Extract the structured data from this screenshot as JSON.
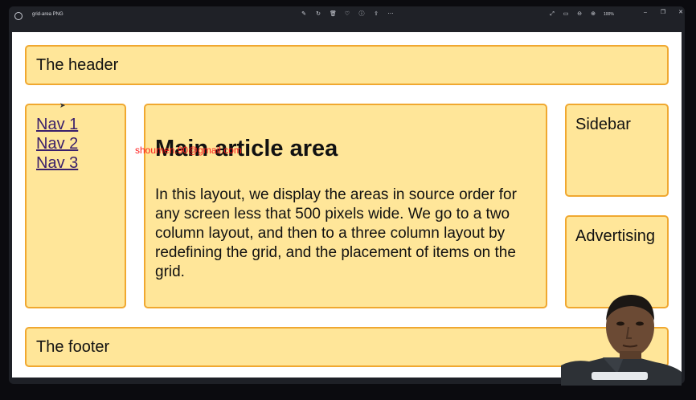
{
  "window": {
    "title": "grid-area PNG",
    "zoom": "100%",
    "tools": [
      "edit-icon",
      "rotate-icon",
      "delete-icon",
      "favorite-icon",
      "info-icon",
      "share-icon",
      "more-icon"
    ]
  },
  "page": {
    "header": "The header",
    "nav": [
      "Nav 1",
      "Nav 2",
      "Nav 3"
    ],
    "main_title": "Main article area",
    "main_body": "In this layout, we display the areas in source order for any screen less that 500 pixels wide. We go to a two column layout, and then to a three column layout by redefining the grid, and the placement of items on the grid.",
    "sidebar": "Sidebar",
    "advertising": "Advertising",
    "footer": "The footer",
    "watermark": "shoumen.90@gmail.com"
  },
  "colors": {
    "box_fill": "#ffe699",
    "box_border": "#f0a830",
    "watermark": "#ff1a1a"
  }
}
